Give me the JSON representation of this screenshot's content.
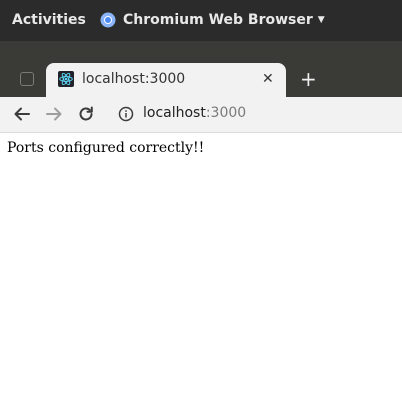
{
  "system_bar": {
    "activities_label": "Activities",
    "app_name": "Chromium Web Browser",
    "app_icon": "chromium-icon",
    "menu_icon": "caret-down-icon"
  },
  "tab": {
    "title": "localhost:3000",
    "favicon": "react-icon",
    "close_icon": "close-icon"
  },
  "new_tab_icon": "plus-icon",
  "toolbar": {
    "back_icon": "arrow-left-icon",
    "forward_icon": "arrow-right-icon",
    "reload_icon": "reload-icon",
    "info_icon": "info-icon",
    "url_host": "localhost",
    "url_port": ":3000"
  },
  "page": {
    "message": "Ports configured correctly!!"
  },
  "colors": {
    "system_bar_bg": "#2b2b2b",
    "tabstrip_bg": "#3a3a37",
    "toolbar_bg": "#f2f2f2",
    "react_blue": "#61dafb",
    "chromium_blue": "#4a8af4"
  }
}
